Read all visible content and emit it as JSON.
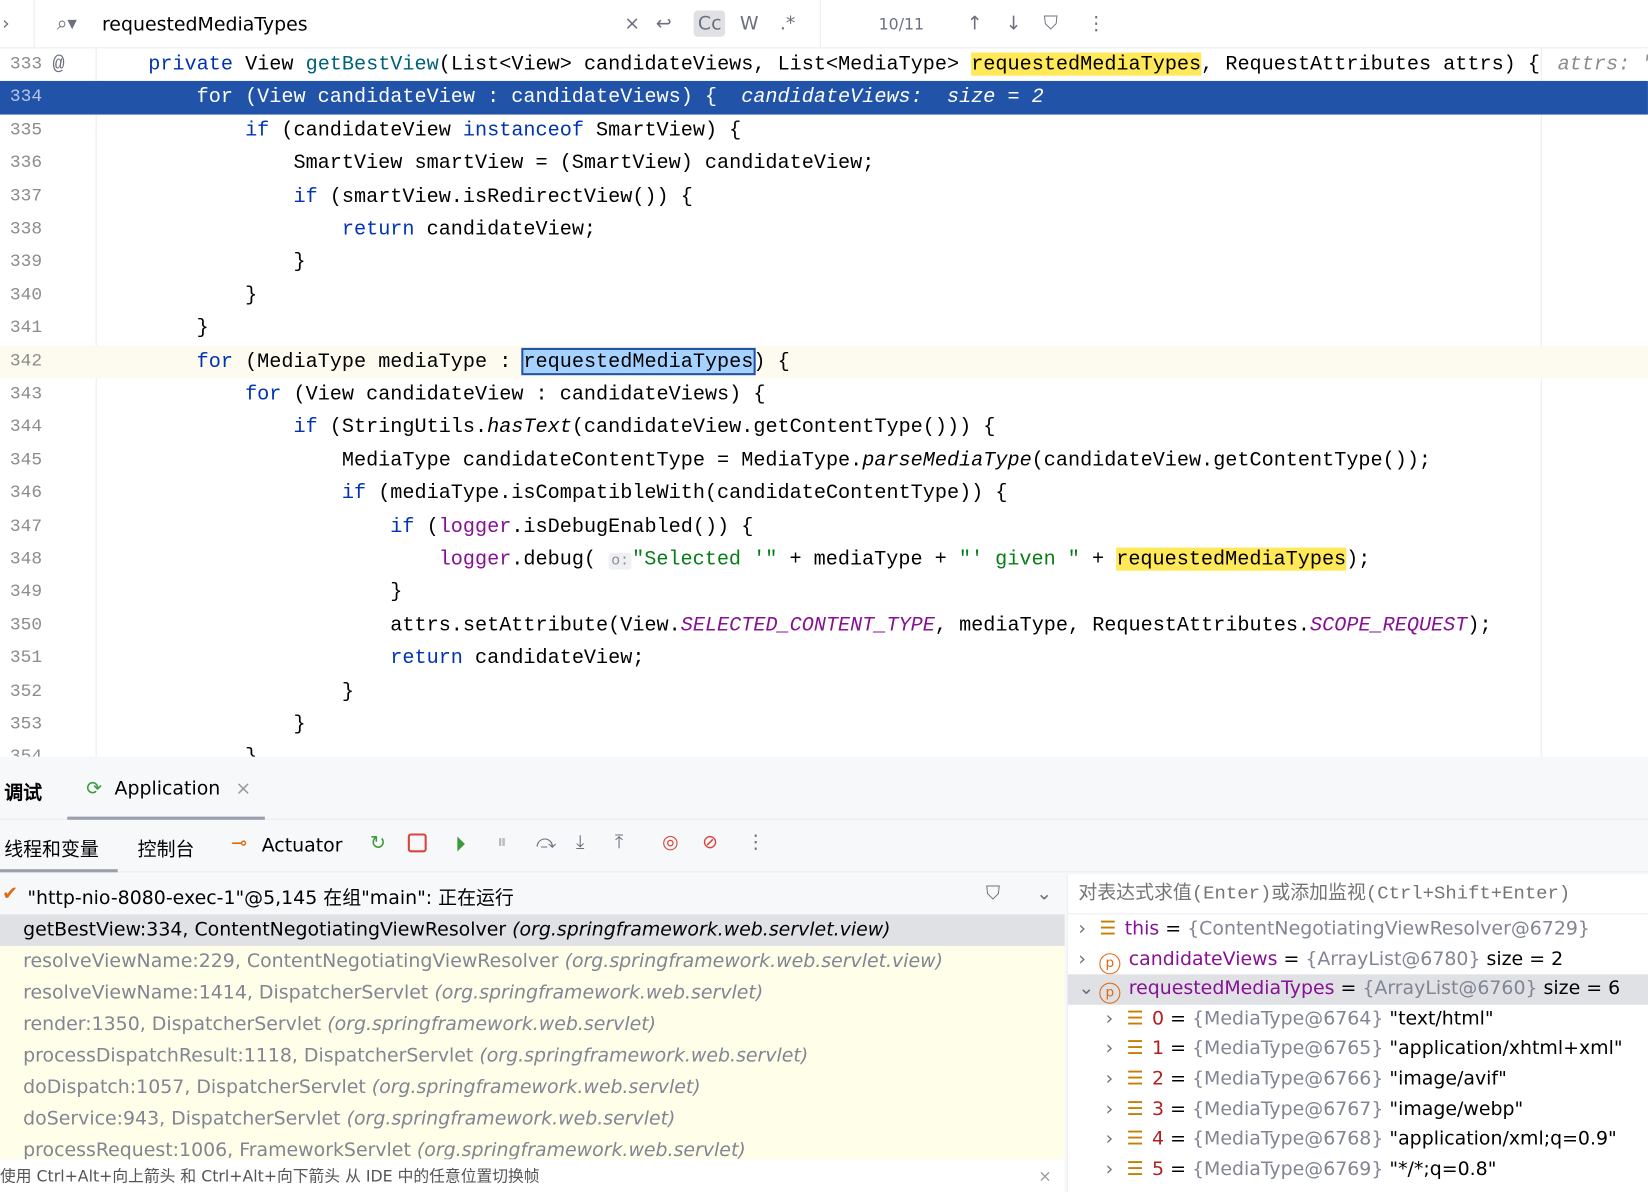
{
  "search": {
    "query": "requestedMediaTypes",
    "match_count": "10/11",
    "case_label": "Cc",
    "word_label": "W",
    "regex_label": ".*"
  },
  "code": {
    "lines": [
      {
        "n": "333",
        "t": [
          [
            "    "
          ],
          [
            "private",
            "kw"
          ],
          [
            " View "
          ],
          [
            "getBestView",
            "fn"
          ],
          [
            "(List<View> candidateViews, List<MediaType> "
          ],
          [
            "requestedMediaTypes",
            "hl"
          ],
          [
            ", RequestAttributes attrs) {"
          ]
        ],
        "hint": "attrs: \""
      },
      {
        "n": "334",
        "sel": true,
        "t": [
          [
            "        for (View candidateView : candidateViews) {  "
          ],
          [
            "candidateViews:  size = 2",
            "hint"
          ]
        ]
      },
      {
        "n": "335",
        "t": [
          [
            "            "
          ],
          [
            "if",
            "kw"
          ],
          [
            " (candidateView "
          ],
          [
            "instanceof",
            "kw"
          ],
          [
            " SmartView) {"
          ]
        ]
      },
      {
        "n": "336",
        "t": [
          [
            "                SmartView smartView = (SmartView) candidateView;"
          ]
        ]
      },
      {
        "n": "337",
        "t": [
          [
            "                "
          ],
          [
            "if",
            "kw"
          ],
          [
            " (smartView.isRedirectView()) {"
          ]
        ]
      },
      {
        "n": "338",
        "t": [
          [
            "                    "
          ],
          [
            "return",
            "kw"
          ],
          [
            " candidateView;"
          ]
        ]
      },
      {
        "n": "339",
        "t": [
          [
            "                }"
          ]
        ]
      },
      {
        "n": "340",
        "t": [
          [
            "            }"
          ]
        ]
      },
      {
        "n": "341",
        "t": [
          [
            "        }"
          ]
        ]
      },
      {
        "n": "342",
        "cur": true,
        "t": [
          [
            "        "
          ],
          [
            "for",
            "kw"
          ],
          [
            " (MediaType mediaType : "
          ],
          [
            "requestedMediaTypes",
            "box"
          ],
          [
            ") {"
          ]
        ]
      },
      {
        "n": "343",
        "t": [
          [
            "            "
          ],
          [
            "for",
            "kw"
          ],
          [
            " (View candidateView : candidateViews) {"
          ]
        ]
      },
      {
        "n": "344",
        "t": [
          [
            "                "
          ],
          [
            "if",
            "kw"
          ],
          [
            " (StringUtils."
          ],
          [
            "hasText",
            "it"
          ],
          [
            "(candidateView.getContentType())) {"
          ]
        ]
      },
      {
        "n": "345",
        "t": [
          [
            "                    MediaType candidateContentType = MediaType."
          ],
          [
            "parseMediaType",
            "it"
          ],
          [
            "(candidateView.getContentType());"
          ]
        ]
      },
      {
        "n": "346",
        "t": [
          [
            "                    "
          ],
          [
            "if",
            "kw"
          ],
          [
            " (mediaType.isCompatibleWith(candidateContentType)) {"
          ]
        ]
      },
      {
        "n": "347",
        "t": [
          [
            "                        "
          ],
          [
            "if",
            "kw"
          ],
          [
            " ("
          ],
          [
            "logger",
            "fld"
          ],
          [
            ".isDebugEnabled()) {"
          ]
        ]
      },
      {
        "n": "348",
        "t": [
          [
            "                            "
          ],
          [
            "logger",
            "fld"
          ],
          [
            ".debug( "
          ],
          [
            "o:",
            "param"
          ],
          [
            "\"Selected '\"",
            "str"
          ],
          [
            " + mediaType + "
          ],
          [
            "\"' given \"",
            "str"
          ],
          [
            " + "
          ],
          [
            "requestedMediaTypes",
            "hl"
          ],
          [
            ");"
          ]
        ]
      },
      {
        "n": "349",
        "t": [
          [
            "                        }"
          ]
        ]
      },
      {
        "n": "350",
        "t": [
          [
            "                        attrs.setAttribute(View."
          ],
          [
            "SELECTED_CONTENT_TYPE",
            "cst"
          ],
          [
            ", mediaType, RequestAttributes."
          ],
          [
            "SCOPE_REQUEST",
            "cst"
          ],
          [
            ");"
          ]
        ]
      },
      {
        "n": "351",
        "t": [
          [
            "                        "
          ],
          [
            "return",
            "kw"
          ],
          [
            " candidateView;"
          ]
        ]
      },
      {
        "n": "352",
        "t": [
          [
            "                    }"
          ]
        ]
      },
      {
        "n": "353",
        "t": [
          [
            "                }"
          ]
        ]
      },
      {
        "n": "354",
        "t": [
          [
            "            }"
          ]
        ]
      }
    ]
  },
  "debug": {
    "tab_debug": "调试",
    "tab_app": "Application",
    "sub_threads": "线程和变量",
    "sub_console": "控制台",
    "sub_actuator": "Actuator",
    "thread": "\"http-nio-8080-exec-1\"@5,145 在组\"main\": 正在运行",
    "eval_placeholder": "对表达式求值(Enter)或添加监视(Ctrl+Shift+Enter)",
    "frames": [
      {
        "m": "getBestView:334, ContentNegotiatingViewResolver",
        "p": "(org.springframework.web.servlet.view)"
      },
      {
        "m": "resolveViewName:229, ContentNegotiatingViewResolver",
        "p": "(org.springframework.web.servlet.view)"
      },
      {
        "m": "resolveViewName:1414, DispatcherServlet",
        "p": "(org.springframework.web.servlet)"
      },
      {
        "m": "render:1350, DispatcherServlet",
        "p": "(org.springframework.web.servlet)"
      },
      {
        "m": "processDispatchResult:1118, DispatcherServlet",
        "p": "(org.springframework.web.servlet)"
      },
      {
        "m": "doDispatch:1057, DispatcherServlet",
        "p": "(org.springframework.web.servlet)"
      },
      {
        "m": "doService:943, DispatcherServlet",
        "p": "(org.springframework.web.servlet)"
      },
      {
        "m": "processRequest:1006, FrameworkServlet",
        "p": "(org.springframework.web.servlet)"
      }
    ],
    "hint": "使用 Ctrl+Alt+向上箭头 和 Ctrl+Alt+向下箭头 从 IDE 中的任意位置切换帧",
    "vars": [
      {
        "name": "this",
        "eq": " = ",
        "ref": "{ContentNegotiatingViewResolver@6729}",
        "extra": "",
        "icon": "field"
      },
      {
        "name": "candidateViews",
        "eq": " = ",
        "ref": "{ArrayList@6780}",
        "extra": " size = 2",
        "icon": "param"
      },
      {
        "name": "requestedMediaTypes",
        "eq": " = ",
        "ref": "{ArrayList@6760}",
        "extra": " size = 6",
        "icon": "param",
        "expanded": true
      }
    ],
    "items": [
      {
        "name": "0",
        "ref": "{MediaType@6764}",
        "val": " \"text/html\""
      },
      {
        "name": "1",
        "ref": "{MediaType@6765}",
        "val": " \"application/xhtml+xml\""
      },
      {
        "name": "2",
        "ref": "{MediaType@6766}",
        "val": " \"image/avif\""
      },
      {
        "name": "3",
        "ref": "{MediaType@6767}",
        "val": " \"image/webp\""
      },
      {
        "name": "4",
        "ref": "{MediaType@6768}",
        "val": " \"application/xml;q=0.9\""
      },
      {
        "name": "5",
        "ref": "{MediaType@6769}",
        "val": " \"*/*;q=0.8\""
      }
    ]
  }
}
